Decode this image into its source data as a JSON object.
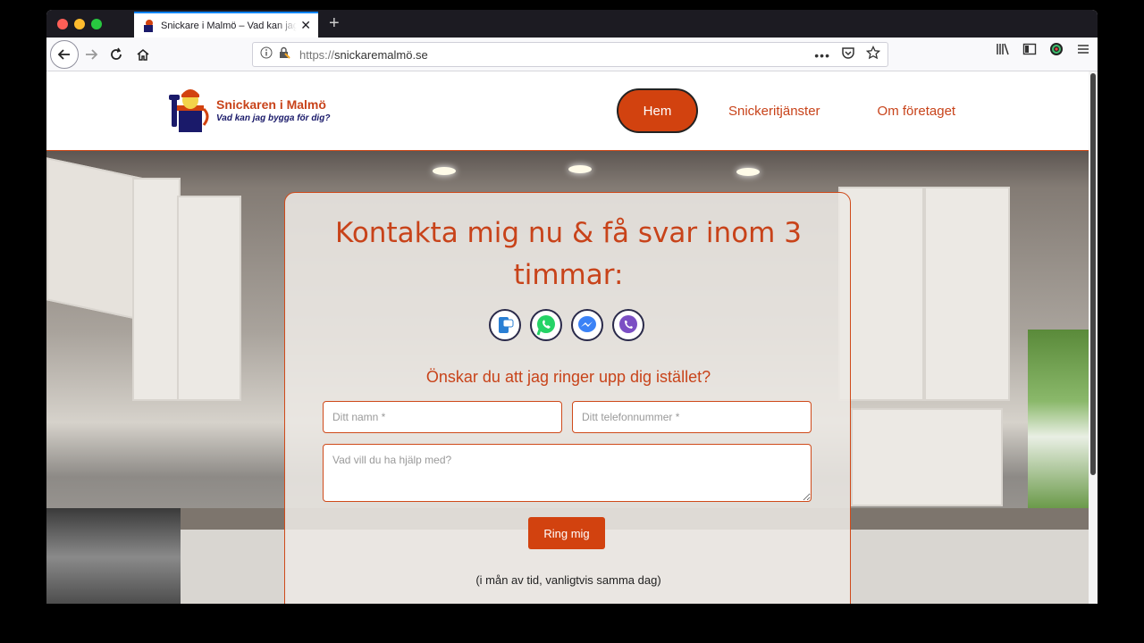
{
  "browser": {
    "tab_title": "Snickare i Malmö – Vad kan jag bygga för dig?",
    "url_prefix": "https://",
    "url_host": "snickaremalmö.se"
  },
  "site": {
    "logo_title": "Snickaren i Malmö",
    "logo_tagline": "Vad kan jag bygga för dig?",
    "menu": [
      "Hem",
      "Snickeritjänster",
      "Om företaget"
    ]
  },
  "contact": {
    "title_line1": "Kontakta mig nu & få svar inom 3",
    "title_line2": "timmar:",
    "chat_icons": [
      "sms-icon",
      "whatsapp-icon",
      "messenger-icon",
      "viber-icon"
    ],
    "subtitle": "Önskar du att jag ringer upp dig istället?",
    "name_placeholder": "Ditt namn *",
    "phone_placeholder": "Ditt telefonnummer *",
    "message_placeholder": "Vad vill du ha hjälp med?",
    "submit_label": "Ring mig",
    "note": "(i mån av tid, vanligtvis samma dag)"
  },
  "colors": {
    "accent": "#d2420f",
    "text_accent": "#c8431a"
  }
}
